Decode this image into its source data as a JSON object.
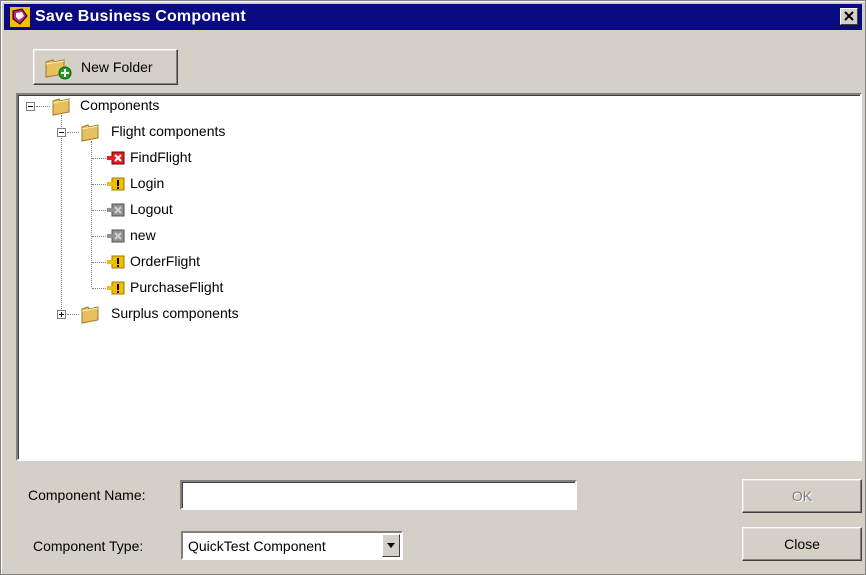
{
  "window": {
    "title": "Save Business Component"
  },
  "toolbar": {
    "new_folder_label": "New Folder"
  },
  "tree": {
    "root": "Components",
    "folders": [
      {
        "label": "Flight components",
        "expanded": true,
        "items": [
          {
            "label": "FindFlight",
            "icon": "component-error-icon",
            "status_color": "#e02020"
          },
          {
            "label": "Login",
            "icon": "component-warning-icon",
            "status_color": "#f0c000"
          },
          {
            "label": "Logout",
            "icon": "component-gray-icon",
            "status_color": "#808080"
          },
          {
            "label": "new",
            "icon": "component-gray-icon",
            "status_color": "#808080"
          },
          {
            "label": "OrderFlight",
            "icon": "component-warning-icon",
            "status_color": "#f0c000"
          },
          {
            "label": "PurchaseFlight",
            "icon": "component-warning-icon",
            "status_color": "#f0c000"
          }
        ]
      },
      {
        "label": "Surplus components",
        "expanded": false,
        "items": []
      }
    ]
  },
  "form": {
    "name_label": "Component Name:",
    "name_value": "",
    "type_label": "Component Type:",
    "type_value": "QuickTest Component"
  },
  "buttons": {
    "ok": "OK",
    "close": "Close"
  },
  "colors": {
    "titlebar": "#0a0a80",
    "dialog_bg": "#d4d0c8",
    "folder": "#e8c060"
  }
}
